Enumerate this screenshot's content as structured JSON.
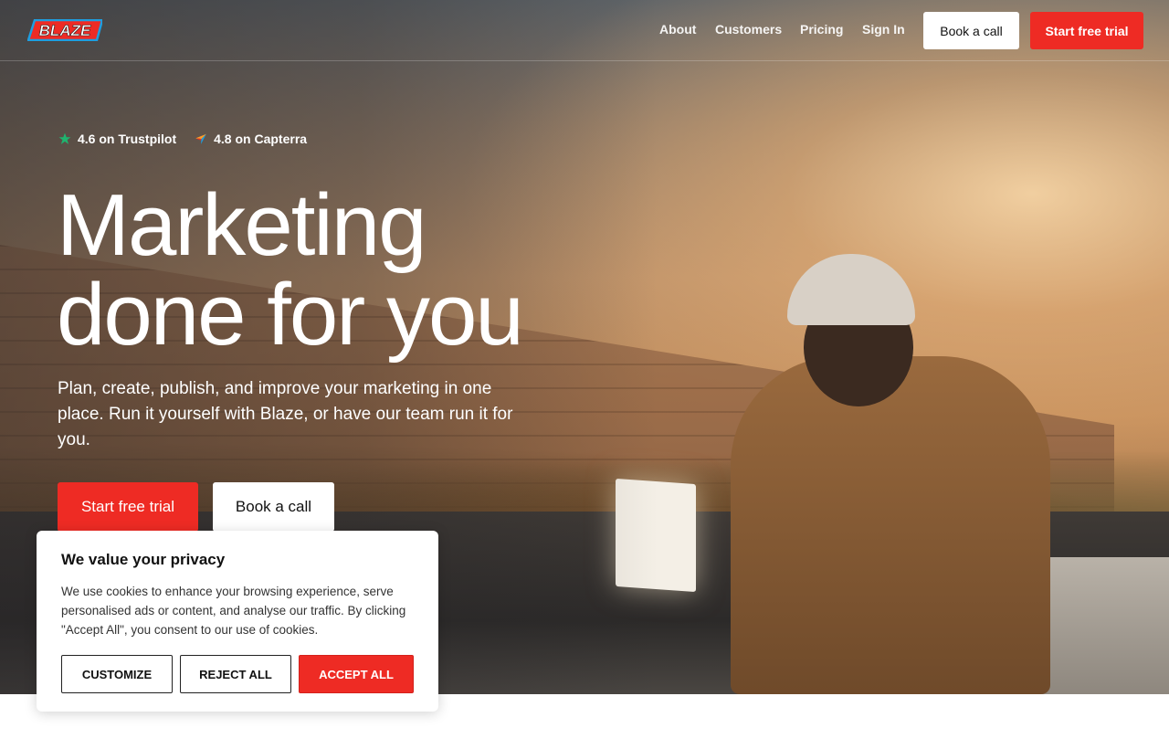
{
  "brand": {
    "logo_text": "BLAZE",
    "accent_color": "#ee2b24",
    "logo_outline_color": "#1e9ee0"
  },
  "nav": {
    "links": [
      "About",
      "Customers",
      "Pricing",
      "Sign In"
    ],
    "book_call_label": "Book a call",
    "start_trial_label": "Start free trial"
  },
  "ratings": [
    {
      "icon": "trustpilot-star-icon",
      "text": "4.6 on Trustpilot"
    },
    {
      "icon": "capterra-arrow-icon",
      "text": "4.8 on Capterra"
    }
  ],
  "hero": {
    "headline_line1": "Marketing",
    "headline_line2": "done for you",
    "subheadline": "Plan, create, publish, and improve your marketing in one place. Run it yourself with Blaze, or have our team run it for you.",
    "primary_cta": "Start free trial",
    "secondary_cta": "Book a call"
  },
  "cookie_banner": {
    "title": "We value your privacy",
    "body": "We use cookies to enhance your browsing experience, serve personalised ads or content, and analyse our traffic. By clicking \"Accept All\", you consent to our use of cookies.",
    "customize_label": "CUSTOMIZE",
    "reject_label": "REJECT ALL",
    "accept_label": "ACCEPT ALL"
  }
}
